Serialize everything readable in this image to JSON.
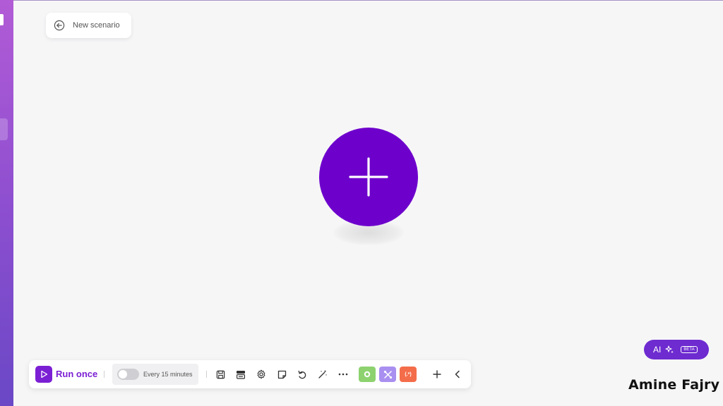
{
  "header": {
    "scenario_name": "New scenario"
  },
  "toolbar": {
    "run_label": "Run once",
    "schedule_label": "Every 15 minutes",
    "schedule_enabled": false,
    "icons": [
      "save-icon",
      "device-icon",
      "settings-gear-icon",
      "note-icon",
      "undo-icon",
      "magic-wand-icon",
      "more-dots-icon"
    ],
    "flow_controls": [
      "router-icon",
      "tools-icon",
      "text-parser-icon"
    ],
    "flow_text": "(.*)",
    "add_icon": "plus-icon",
    "collapse_icon": "chevron-left-icon"
  },
  "ai_assistant": {
    "label": "AI",
    "badge": "BETA"
  },
  "watermark": "Amine Fajry",
  "colors": {
    "accent": "#6e00cc",
    "ai_button": "#6e2bd0",
    "green_control": "#8dd26f",
    "violet_control": "#a98ff0",
    "orange_control": "#f46d4a"
  }
}
